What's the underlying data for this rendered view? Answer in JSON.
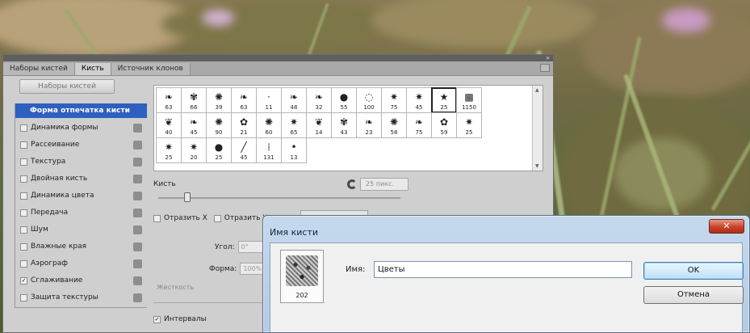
{
  "panel": {
    "tabs": [
      "Наборы кистей",
      "Кисть",
      "Источник клонов"
    ],
    "presets_button": "Наборы кистей",
    "options": [
      {
        "label": "Форма отпечатка кисти",
        "checked": false,
        "selected": true,
        "lock": false
      },
      {
        "label": "Динамика формы",
        "checked": false,
        "selected": false,
        "lock": true
      },
      {
        "label": "Рассеивание",
        "checked": false,
        "selected": false,
        "lock": true
      },
      {
        "label": "Текстура",
        "checked": false,
        "selected": false,
        "lock": true
      },
      {
        "label": "Двойная кисть",
        "checked": false,
        "selected": false,
        "lock": true
      },
      {
        "label": "Динамика цвета",
        "checked": false,
        "selected": false,
        "lock": true
      },
      {
        "label": "Передача",
        "checked": false,
        "selected": false,
        "lock": true
      },
      {
        "label": "Шум",
        "checked": false,
        "selected": false,
        "lock": true
      },
      {
        "label": "Влажные края",
        "checked": false,
        "selected": false,
        "lock": true
      },
      {
        "label": "Аэрограф",
        "checked": false,
        "selected": false,
        "lock": true
      },
      {
        "label": "Сглаживание",
        "checked": true,
        "selected": false,
        "lock": true
      },
      {
        "label": "Защита текстуры",
        "checked": false,
        "selected": false,
        "lock": true
      }
    ],
    "brushes": [
      {
        "size": "63",
        "glyph": "❧"
      },
      {
        "size": "66",
        "glyph": "✾"
      },
      {
        "size": "39",
        "glyph": "✺"
      },
      {
        "size": "63",
        "glyph": "❧"
      },
      {
        "size": "11",
        "glyph": "·"
      },
      {
        "size": "48",
        "glyph": "❧"
      },
      {
        "size": "32",
        "glyph": "❧"
      },
      {
        "size": "55",
        "glyph": "●"
      },
      {
        "size": "100",
        "glyph": "◌"
      },
      {
        "size": "75",
        "glyph": "✷"
      },
      {
        "size": "45",
        "glyph": "✷"
      },
      {
        "size": "25",
        "glyph": "★",
        "selected": true
      },
      {
        "size": "1150",
        "glyph": "▩"
      },
      {
        "size": "40",
        "glyph": "❦"
      },
      {
        "size": "45",
        "glyph": "❧"
      },
      {
        "size": "90",
        "glyph": "✺"
      },
      {
        "size": "21",
        "glyph": "✿"
      },
      {
        "size": "60",
        "glyph": "✺"
      },
      {
        "size": "65",
        "glyph": "✷"
      },
      {
        "size": "14",
        "glyph": "❦"
      },
      {
        "size": "43",
        "glyph": "✾"
      },
      {
        "size": "23",
        "glyph": "❧"
      },
      {
        "size": "58",
        "glyph": "✺"
      },
      {
        "size": "75",
        "glyph": "❧"
      },
      {
        "size": "59",
        "glyph": "✿"
      },
      {
        "size": "25",
        "glyph": "✷"
      },
      {
        "size": "25",
        "glyph": "✷"
      },
      {
        "size": "20",
        "glyph": "✷"
      },
      {
        "size": "25",
        "glyph": "●"
      },
      {
        "size": "45",
        "glyph": "╱"
      },
      {
        "size": "131",
        "glyph": "⁞"
      },
      {
        "size": "13",
        "glyph": "•"
      }
    ],
    "size_label": "Кисть",
    "size_value": "25 пикс.",
    "flip_x": "Отразить X",
    "flip_y": "Отразить Y",
    "angle_label": "Угол:",
    "angle_value": "0°",
    "roundness_label": "Форма:",
    "roundness_value": "100%",
    "hardness_label": "Жесткость",
    "spacing_label": "Интервалы",
    "spacing_checked": true
  },
  "dialog": {
    "title": "Имя кисти",
    "close": "✕",
    "thumb_number": "202",
    "name_label": "Имя:",
    "name_value": "Цветы",
    "ok": "OK",
    "cancel": "Отмена"
  }
}
